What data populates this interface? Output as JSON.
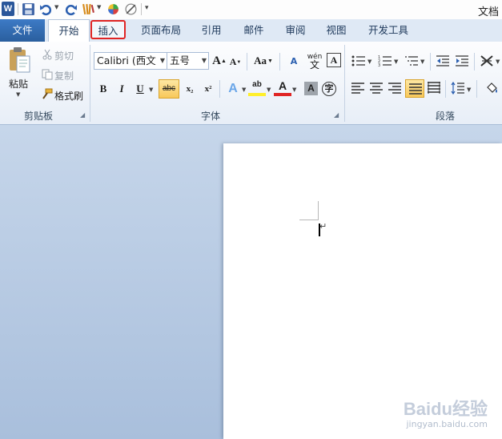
{
  "window": {
    "title": "文档"
  },
  "quick_access": {
    "app_icon": "W",
    "icons": [
      "save-icon",
      "undo-icon",
      "redo-icon",
      "format-painter-icon",
      "color-icon",
      "brush-icon",
      "customize-icon"
    ]
  },
  "tabs": {
    "file": "文件",
    "home": "开始",
    "insert": "插入",
    "page_layout": "页面布局",
    "references": "引用",
    "mailings": "邮件",
    "review": "审阅",
    "view": "视图",
    "developer": "开发工具"
  },
  "clipboard": {
    "paste": "粘贴",
    "cut": "剪切",
    "copy": "复制",
    "format_painter": "格式刷",
    "group_label": "剪贴板"
  },
  "font": {
    "font_name": "Calibri (西文",
    "font_size": "五号",
    "grow": "A",
    "shrink": "A",
    "change_case": "Aa",
    "clear": "A",
    "phonetic": "wén",
    "border": "A",
    "bold": "B",
    "italic": "I",
    "underline": "U",
    "strikethrough": "abc",
    "subscript": "x₂",
    "superscript": "x²",
    "text_effect": "A",
    "highlight": "ab",
    "font_color": "A",
    "shading": "A",
    "enclose": "字",
    "group_label": "字体"
  },
  "paragraph": {
    "group_label": "段落"
  },
  "watermark": {
    "logo": "Baidu经验",
    "sub": "jingyan.baidu.com"
  },
  "colors": {
    "file_tab": "#2a5f9e",
    "highlight_outline": "#e02424",
    "workspace": "#b8cbe4",
    "pressed": "#f8c85a"
  }
}
